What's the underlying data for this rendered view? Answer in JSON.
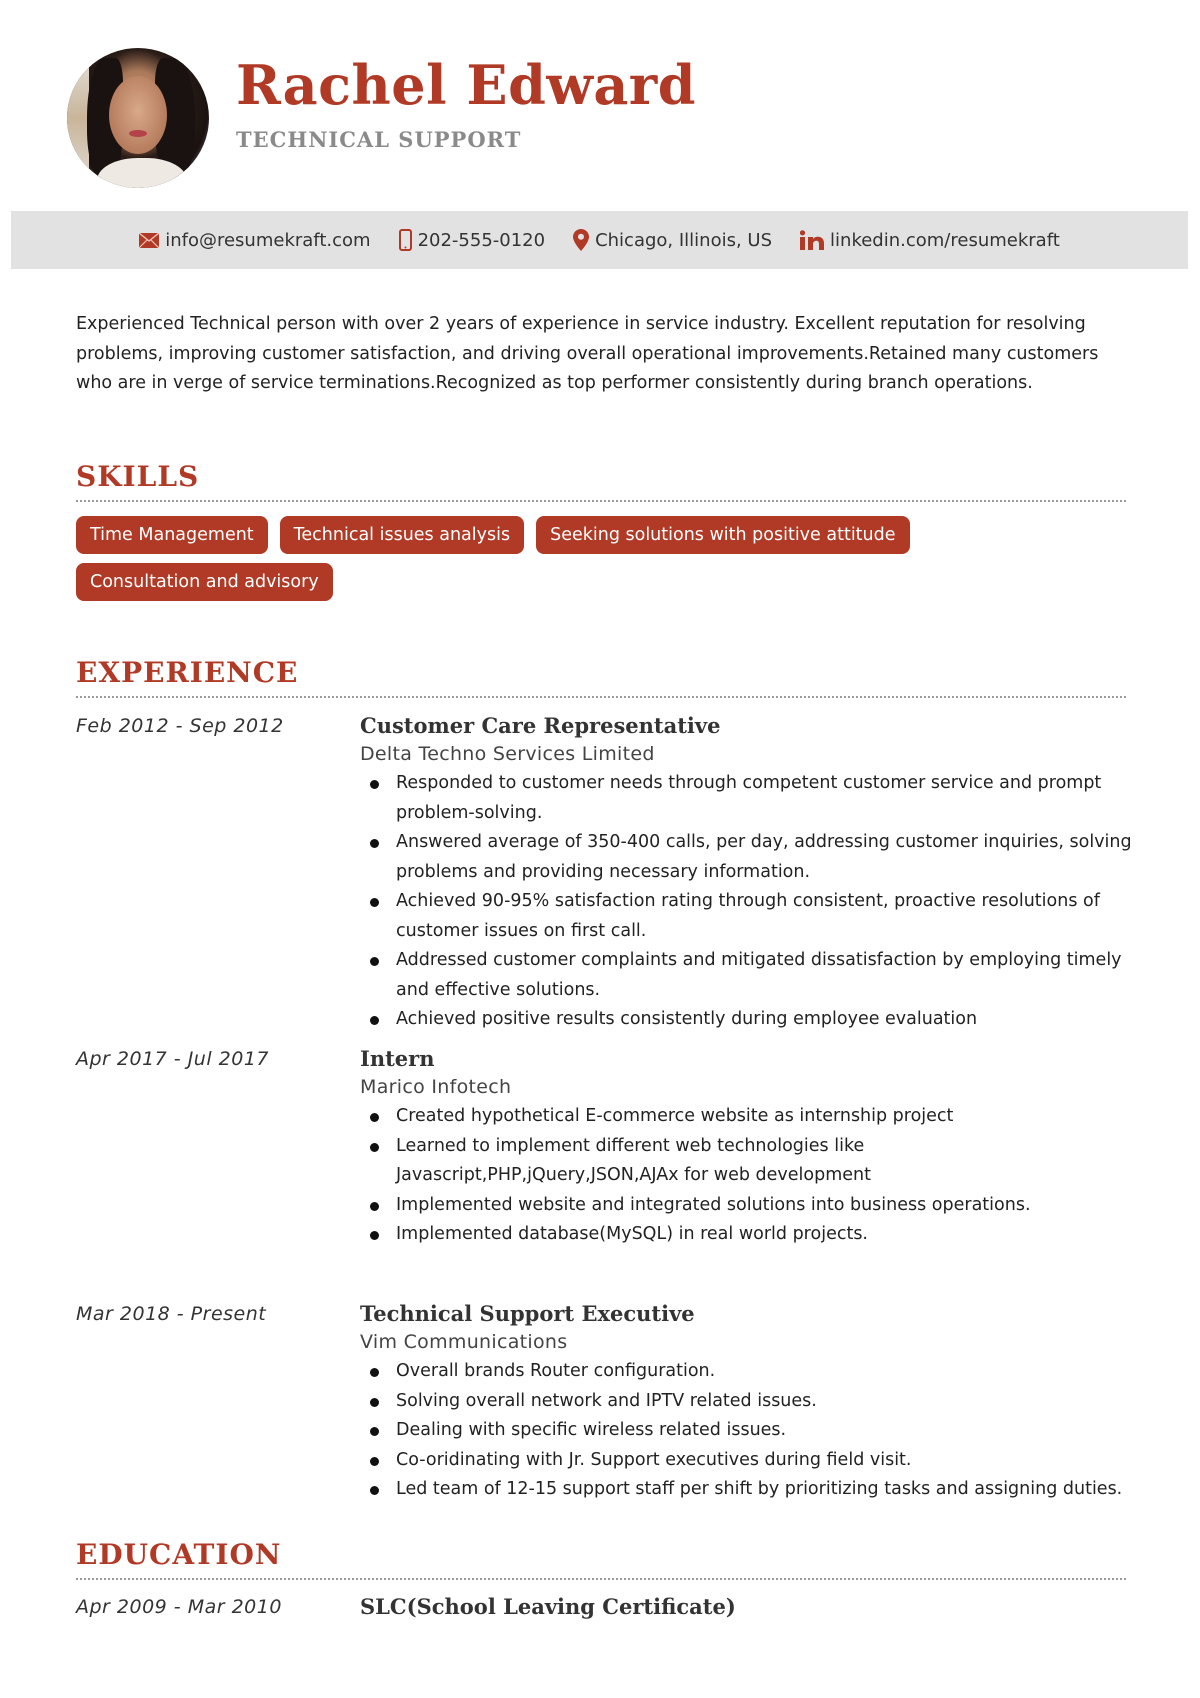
{
  "header": {
    "name": "Rachel Edward",
    "role": "TECHNICAL SUPPORT",
    "photo_alt": "profile-photo"
  },
  "contact": {
    "email": {
      "icon": "envelope-icon",
      "text": "info@resumekraft.com"
    },
    "phone": {
      "icon": "mobile-phone-icon",
      "text": "202-555-0120"
    },
    "location": {
      "icon": "map-pin-icon",
      "text": "Chicago, Illinois, US"
    },
    "linkedin": {
      "icon": "linkedin-icon",
      "text": "linkedin.com/resumekraft"
    }
  },
  "summary": "Experienced Technical person with over 2 years of experience in service industry. Excellent reputation for resolving problems, improving customer satisfaction, and driving overall operational improvements.Retained many customers who are in verge of service terminations.Recognized as top performer consistently during branch operations.",
  "skills": {
    "title": "SKILLS",
    "items": [
      "Time Management",
      "Technical issues analysis",
      "Seeking solutions with positive attitude",
      "Consultation and advisory"
    ]
  },
  "experience": {
    "title": "EXPERIENCE",
    "items": [
      {
        "dates": "Feb 2012 - Sep 2012",
        "title": "Customer Care Representative",
        "company": "Delta Techno Services Limited",
        "bullets": [
          "Responded to customer needs through competent customer service and prompt problem-solving.",
          "Answered average of 350-400 calls, per day, addressing customer inquiries, solving problems and providing necessary information.",
          "Achieved 90-95% satisfaction rating through consistent, proactive resolutions of customer issues on first call.",
          "Addressed customer complaints and mitigated dissatisfaction by employing timely and effective solutions.",
          "Achieved positive results consistently during employee evaluation"
        ]
      },
      {
        "dates": "Apr 2017 - Jul 2017",
        "title": "Intern",
        "company": "Marico Infotech",
        "bullets": [
          "Created hypothetical E-commerce website as internship project",
          "Learned to implement different web technologies like Javascript,PHP,jQuery,JSON,AJAx for web development",
          "Implemented website and integrated solutions into business operations.",
          "Implemented database(MySQL) in real world projects."
        ]
      },
      {
        "dates": "Mar 2018 - Present",
        "title": "Technical Support Executive",
        "company": "Vim Communications",
        "bullets": [
          "Overall brands Router configuration.",
          "Solving overall network and IPTV related issues.",
          "Dealing with specific wireless related issues.",
          "Co-oridinating with Jr. Support executives during field visit.",
          "Led team of 12-15 support staff per shift by prioritizing tasks and assigning duties."
        ]
      }
    ]
  },
  "education": {
    "title": "EDUCATION",
    "items": [
      {
        "dates": "Apr 2009 - Mar 2010",
        "title": "SLC(School Leaving Certificate)"
      }
    ]
  },
  "colors": {
    "accent": "#b03a26",
    "contact_bar": "#e2e2e2",
    "subtitle_gray": "#8a8a8a"
  }
}
